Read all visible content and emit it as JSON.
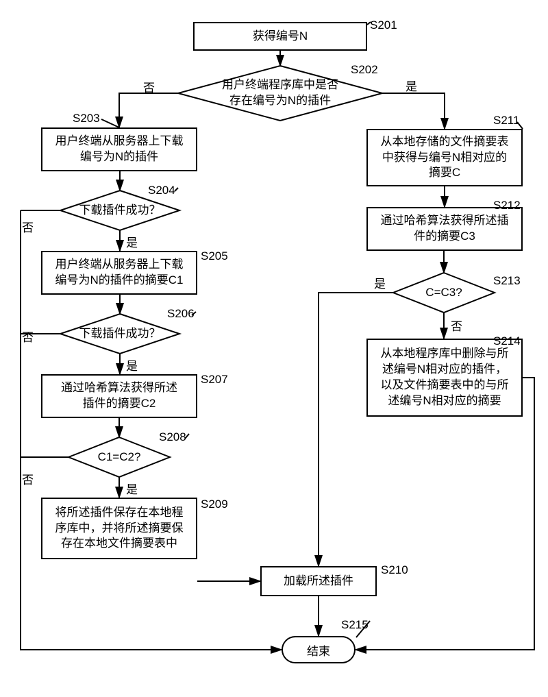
{
  "domain": "Diagram",
  "steps": {
    "s201": {
      "label": "获得编号N"
    },
    "s202": {
      "label": "用户终端程序库中是否\n存在编号为N的插件"
    },
    "s203": {
      "label": "用户终端从服务器上下载\n编号为N的插件"
    },
    "s204": {
      "label": "下载插件成功？"
    },
    "s205": {
      "label": "用户终端从服务器上下载\n编号为N的插件的摘要C1"
    },
    "s206": {
      "label": "下载插件成功？"
    },
    "s207": {
      "label": "通过哈希算法获得所述\n插件的摘要C2"
    },
    "s208": {
      "label": "C1=C2?"
    },
    "s209": {
      "label": "将所述插件保存在本地程\n序库中，并将所述摘要保\n存在本地文件摘要表中"
    },
    "s210": {
      "label": "加载所述插件"
    },
    "s211": {
      "label": "从本地存储的文件摘要表\n中获得与编号N相对应的\n摘要C"
    },
    "s212": {
      "label": "通过哈希算法获得所述插\n件的摘要C3"
    },
    "s213": {
      "label": "C=C3?"
    },
    "s214": {
      "label": "从本地程序库中删除与所\n述编号N相对应的插件，\n以及文件摘要表中的与所\n述编号N相对应的摘要"
    },
    "end": {
      "label": "结束"
    }
  },
  "tags": {
    "s201": "S201",
    "s202": "S202",
    "s203": "S203",
    "s204": "S204",
    "s205": "S205",
    "s206": "S206",
    "s207": "S207",
    "s208": "S208",
    "s209": "S209",
    "s210": "S210",
    "s211": "S211",
    "s212": "S212",
    "s213": "S213",
    "s214": "S214",
    "s215": "S215"
  },
  "edges": {
    "yes": "是",
    "no": "否"
  }
}
